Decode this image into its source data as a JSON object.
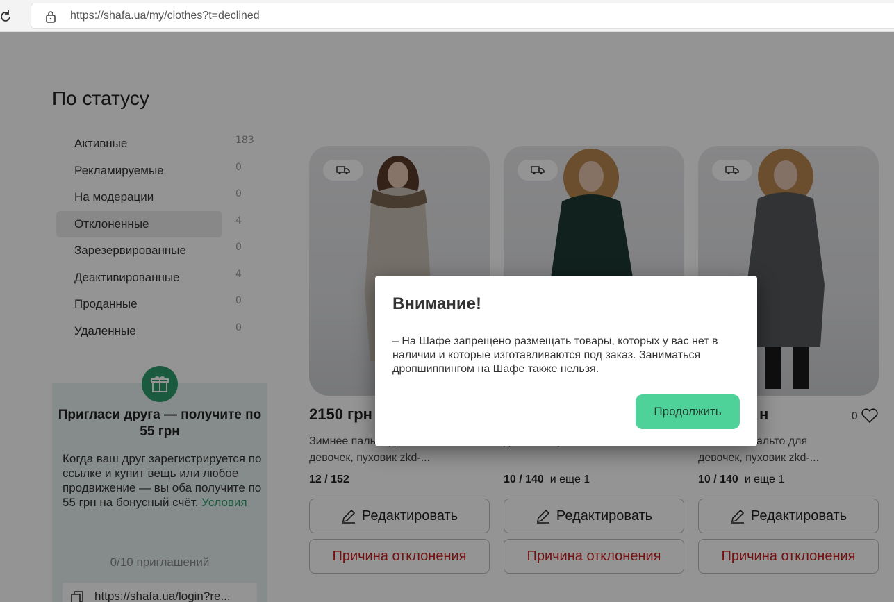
{
  "browser": {
    "url": "https://shafa.ua/my/clothes?t=declined"
  },
  "sidebar": {
    "title": "По статусу",
    "items": [
      {
        "label": "Активные",
        "count": "183"
      },
      {
        "label": "Рекламируемые",
        "count": "0"
      },
      {
        "label": "На модерации",
        "count": "0"
      },
      {
        "label": "Отклоненные",
        "count": "4"
      },
      {
        "label": "Зарезервированные",
        "count": "0"
      },
      {
        "label": "Деактивированные",
        "count": "4"
      },
      {
        "label": "Проданные",
        "count": "0"
      },
      {
        "label": "Удаленные",
        "count": "0"
      }
    ],
    "active_index": 3
  },
  "invite": {
    "title": "Пригласи друга — получите по 55 грн",
    "text": "Когда ваш друг зарегистрируется по ссылке и купит вещь или любое продвижение — вы оба получите по 55 грн на бонусный счёт.",
    "terms_link": "Условия",
    "count": "0/10 приглашений",
    "link": "https://shafa.ua/login?re..."
  },
  "cards": [
    {
      "price": "2150 грн",
      "likes": "",
      "desc_line1": "Зимнее пальто для",
      "desc_line2": "девочек, пуховик zkd-...",
      "sizes": "12 / 152",
      "extra": "",
      "edit_label": "Редактировать",
      "reason_label": "Причина отклонения",
      "coat": "#c9c0b3"
    },
    {
      "price": "",
      "likes": "",
      "desc_line1": "",
      "desc_line2": "девочек, пуховик zkd-...",
      "sizes": "10 / 140",
      "extra": "и еще 1",
      "edit_label": "Редактировать",
      "reason_label": "Причина отклонения",
      "coat": "#1e3a33"
    },
    {
      "price": "н",
      "likes": "0",
      "desc_line1": "альто для",
      "desc_line2": "девочек, пуховик zkd-...",
      "sizes": "10 / 140",
      "extra": "и еще 1",
      "edit_label": "Редактировать",
      "reason_label": "Причина отклонения",
      "coat": "#55585c"
    }
  ],
  "modal": {
    "title": "Внимание!",
    "text": "– На Шафе запрещено размещать товары, которых у вас нет в наличии и которые изготавливаются под заказ. Заниматься дропшиппингом на Шафе также нельзя.",
    "button": "Продолжить"
  },
  "colors": {
    "accent_green": "#4fd29a",
    "brand_green": "#2e9e6d",
    "reason_red": "#c41a1a"
  }
}
